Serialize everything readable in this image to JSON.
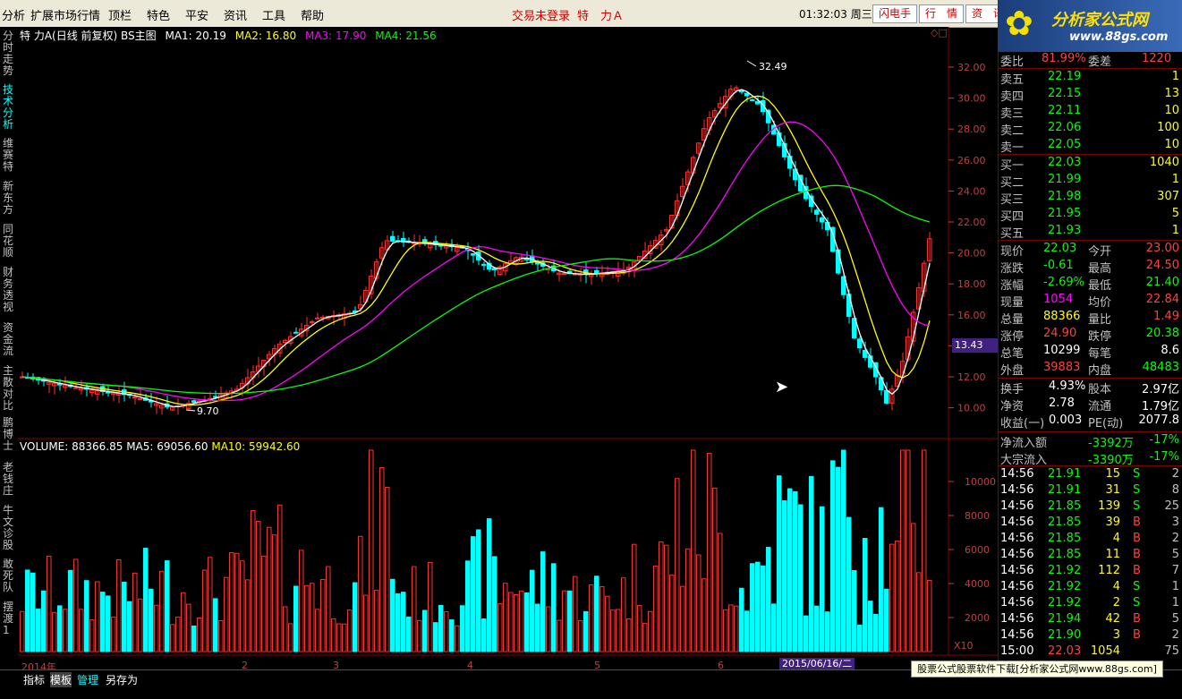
{
  "menu": {
    "items": [
      "分析",
      "扩展市场行情",
      "顶栏",
      "特色",
      "平安",
      "资讯",
      "工具",
      "帮助"
    ]
  },
  "header": {
    "notice": "交易未登录",
    "stock_title": "特　力Ａ",
    "clock": "01:32:03 周三",
    "buttons": [
      "闪电手",
      "行　情",
      "资　讯"
    ]
  },
  "logo": {
    "title": "分析家公式网",
    "url": "www.88gs.com"
  },
  "left_tabs": [
    "分时走势",
    "技术分析",
    "维赛特",
    "新东方",
    "同花顺",
    "财务透视",
    "资金流",
    "主散对比",
    "鹏博士",
    "老钱庄",
    "牛文诊股",
    "敢死队",
    "摆渡1"
  ],
  "kline": {
    "title": "特 力A(日线 前复权) BS主图",
    "ma": [
      {
        "label": "MA1: 20.19",
        "color": "#ffffff"
      },
      {
        "label": "MA2: 16.80",
        "color": "#ffff00"
      },
      {
        "label": "MA3: 17.90",
        "color": "#ff00ff"
      },
      {
        "label": "MA4: 21.56",
        "color": "#00ff00"
      }
    ],
    "high_label": "32.49",
    "low_label": "9.70",
    "y_ticks": [
      "32.00",
      "30.00",
      "28.00",
      "26.00",
      "24.00",
      "22.00",
      "20.00",
      "18.00",
      "16.00",
      "14.00",
      "12.00",
      "10.00"
    ],
    "current_price_box": "13.43"
  },
  "volume": {
    "title": "VOLUME: 88366.85",
    "ma5": "MA5: 69056.60",
    "ma10": "MA10: 59942.60",
    "y_ticks": [
      "10000",
      "8000",
      "6000",
      "4000",
      "2000"
    ],
    "unit": "X10"
  },
  "x_axis": {
    "labels": [
      "2014年",
      "2",
      "3",
      "4",
      "5",
      "6"
    ],
    "date_box": "2015/06/16/二"
  },
  "order_book": {
    "wei_bi": {
      "label": "委比",
      "value": "81.99%",
      "label2": "委差",
      "value2": "1220"
    },
    "sell": [
      {
        "label": "卖五",
        "price": "22.19",
        "vol": "1"
      },
      {
        "label": "卖四",
        "price": "22.15",
        "vol": "13"
      },
      {
        "label": "卖三",
        "price": "22.11",
        "vol": "10"
      },
      {
        "label": "卖二",
        "price": "22.06",
        "vol": "100"
      },
      {
        "label": "卖一",
        "price": "22.05",
        "vol": "10"
      }
    ],
    "buy": [
      {
        "label": "买一",
        "price": "22.03",
        "vol": "1040"
      },
      {
        "label": "买二",
        "price": "21.99",
        "vol": "1"
      },
      {
        "label": "买三",
        "price": "21.98",
        "vol": "307"
      },
      {
        "label": "买四",
        "price": "21.95",
        "vol": "5"
      },
      {
        "label": "买五",
        "price": "21.93",
        "vol": "1"
      }
    ]
  },
  "quote": [
    {
      "l1": "现价",
      "v1": "22.03",
      "c1": "#00ff00",
      "l2": "今开",
      "v2": "23.00",
      "c2": "#ff4040"
    },
    {
      "l1": "涨跌",
      "v1": "-0.61",
      "c1": "#00ff00",
      "l2": "最高",
      "v2": "24.50",
      "c2": "#ff4040"
    },
    {
      "l1": "涨幅",
      "v1": "-2.69%",
      "c1": "#00ff00",
      "l2": "最低",
      "v2": "21.40",
      "c2": "#00ff00"
    },
    {
      "l1": "现量",
      "v1": "1054",
      "c1": "#ff00ff",
      "l2": "均价",
      "v2": "22.84",
      "c2": "#ff4040"
    },
    {
      "l1": "总量",
      "v1": "88366",
      "c1": "#ffff00",
      "l2": "量比",
      "v2": "1.49",
      "c2": "#ff4040"
    },
    {
      "l1": "涨停",
      "v1": "24.90",
      "c1": "#ff4040",
      "l2": "跌停",
      "v2": "20.38",
      "c2": "#00ff00"
    },
    {
      "l1": "总笔",
      "v1": "10299",
      "c1": "#ffffff",
      "l2": "每笔",
      "v2": "8.6",
      "c2": "#ffffff"
    },
    {
      "l1": "外盘",
      "v1": "39883",
      "c1": "#ff4040",
      "l2": "内盘",
      "v2": "48483",
      "c2": "#00ff00"
    }
  ],
  "finance": [
    {
      "l1": "换手",
      "v1": "4.93%",
      "l2": "股本",
      "v2": "2.97亿"
    },
    {
      "l1": "净资",
      "v1": "2.78",
      "l2": "流通",
      "v2": "1.79亿"
    },
    {
      "l1": "收益(一)",
      "v1": "0.003",
      "l2": "PE(动)",
      "v2": "2077.8"
    }
  ],
  "flows": [
    {
      "label": "净流入额",
      "value": "-3392万",
      "pct": "-17%"
    },
    {
      "label": "大宗流入",
      "value": "-3390万",
      "pct": "-17%"
    }
  ],
  "ticks": [
    {
      "time": "14:56",
      "price": "21.91",
      "vol": "15",
      "bs": "S",
      "n": "2"
    },
    {
      "time": "14:56",
      "price": "21.91",
      "vol": "31",
      "bs": "S",
      "n": "8"
    },
    {
      "time": "14:56",
      "price": "21.85",
      "vol": "139",
      "bs": "S",
      "n": "25"
    },
    {
      "time": "14:56",
      "price": "21.85",
      "vol": "39",
      "bs": "B",
      "n": "3"
    },
    {
      "time": "14:56",
      "price": "21.85",
      "vol": "4",
      "bs": "B",
      "n": "2"
    },
    {
      "time": "14:56",
      "price": "21.85",
      "vol": "11",
      "bs": "B",
      "n": "5"
    },
    {
      "time": "14:56",
      "price": "21.92",
      "vol": "112",
      "bs": "B",
      "n": "7"
    },
    {
      "time": "14:56",
      "price": "21.92",
      "vol": "4",
      "bs": "S",
      "n": "1"
    },
    {
      "time": "14:56",
      "price": "21.92",
      "vol": "2",
      "bs": "S",
      "n": "1"
    },
    {
      "time": "14:56",
      "price": "21.94",
      "vol": "42",
      "bs": "B",
      "n": "5"
    },
    {
      "time": "14:56",
      "price": "21.90",
      "vol": "3",
      "bs": "B",
      "n": "2"
    },
    {
      "time": "15:00",
      "price": "22.03",
      "vol": "1054",
      "bs": "",
      "n": "75"
    }
  ],
  "bottom_tabs": [
    "指标",
    "模板",
    "管理",
    "另存为"
  ],
  "footer_ad": "股票公式股票软件下载[分析家公式网www.88gs.com]",
  "colors": {
    "up": "#ff3030",
    "down": "#00ffff",
    "bg": "#000000",
    "grid": "#800000"
  }
}
